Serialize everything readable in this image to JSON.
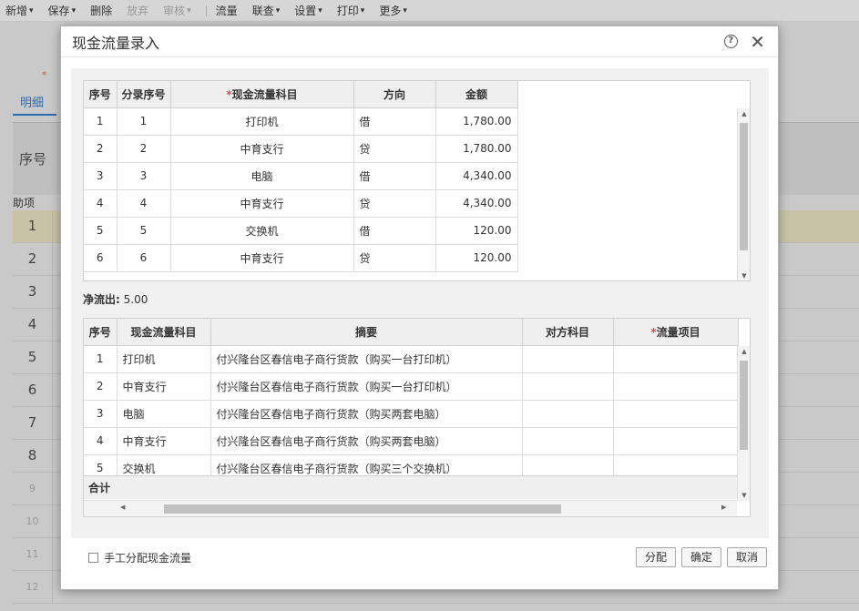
{
  "toolbar": {
    "items": [
      {
        "label": "新增",
        "arrow": true,
        "dim": false
      },
      {
        "label": "保存",
        "arrow": true,
        "dim": false
      },
      {
        "label": "删除",
        "arrow": false,
        "dim": false
      },
      {
        "label": "放弃",
        "arrow": false,
        "dim": true
      },
      {
        "label": "审核",
        "arrow": true,
        "dim": true
      },
      {
        "label": "流量",
        "arrow": false,
        "dim": false
      },
      {
        "label": "联查",
        "arrow": true,
        "dim": false
      },
      {
        "label": "设置",
        "arrow": true,
        "dim": false
      },
      {
        "label": "打印",
        "arrow": true,
        "dim": false
      },
      {
        "label": "更多",
        "arrow": true,
        "dim": false
      }
    ]
  },
  "background": {
    "tab_label": "明细",
    "grid_header_seq": "序号",
    "grid_header_aux": "助项",
    "row_numbers": [
      "1",
      "2",
      "3",
      "4",
      "5",
      "6",
      "7",
      "8",
      "9",
      "10",
      "11",
      "12"
    ]
  },
  "dialog": {
    "title": "现金流量录入",
    "cashflow_table": {
      "headers": {
        "seq": "序号",
        "entry_seq": "分录序号",
        "subject": "现金流量科目",
        "direction": "方向",
        "amount": "金额"
      },
      "rows": [
        {
          "seq": "1",
          "entry_seq": "1",
          "subject": "打印机",
          "direction": "借",
          "amount": "1,780.00"
        },
        {
          "seq": "2",
          "entry_seq": "2",
          "subject": "中育支行",
          "direction": "贷",
          "amount": "1,780.00"
        },
        {
          "seq": "3",
          "entry_seq": "3",
          "subject": "电脑",
          "direction": "借",
          "amount": "4,340.00"
        },
        {
          "seq": "4",
          "entry_seq": "4",
          "subject": "中育支行",
          "direction": "贷",
          "amount": "4,340.00"
        },
        {
          "seq": "5",
          "entry_seq": "5",
          "subject": "交换机",
          "direction": "借",
          "amount": "120.00"
        },
        {
          "seq": "6",
          "entry_seq": "6",
          "subject": "中育支行",
          "direction": "贷",
          "amount": "120.00"
        }
      ]
    },
    "net_outflow": {
      "label": "净流出:",
      "value": "5.00"
    },
    "detail_table": {
      "headers": {
        "seq": "序号",
        "subject": "现金流量科目",
        "summary": "摘要",
        "counter_subject": "对方科目",
        "flow_item": "流量项目"
      },
      "rows": [
        {
          "seq": "1",
          "subject": "打印机",
          "summary": "付兴隆台区春信电子商行货款（购买一台打印机）"
        },
        {
          "seq": "2",
          "subject": "中育支行",
          "summary": "付兴隆台区春信电子商行货款（购买一台打印机）"
        },
        {
          "seq": "3",
          "subject": "电脑",
          "summary": "付兴隆台区春信电子商行货款（购买两套电脑）"
        },
        {
          "seq": "4",
          "subject": "中育支行",
          "summary": "付兴隆台区春信电子商行货款（购买两套电脑）"
        },
        {
          "seq": "5",
          "subject": "交换机",
          "summary": "付兴隆台区春信电子商行货款（购买三个交换机）"
        }
      ],
      "total_label": "合计"
    },
    "manual_allocate_label": "手工分配现金流量",
    "buttons": {
      "allocate": "分配",
      "confirm": "确定",
      "cancel": "取消"
    }
  }
}
